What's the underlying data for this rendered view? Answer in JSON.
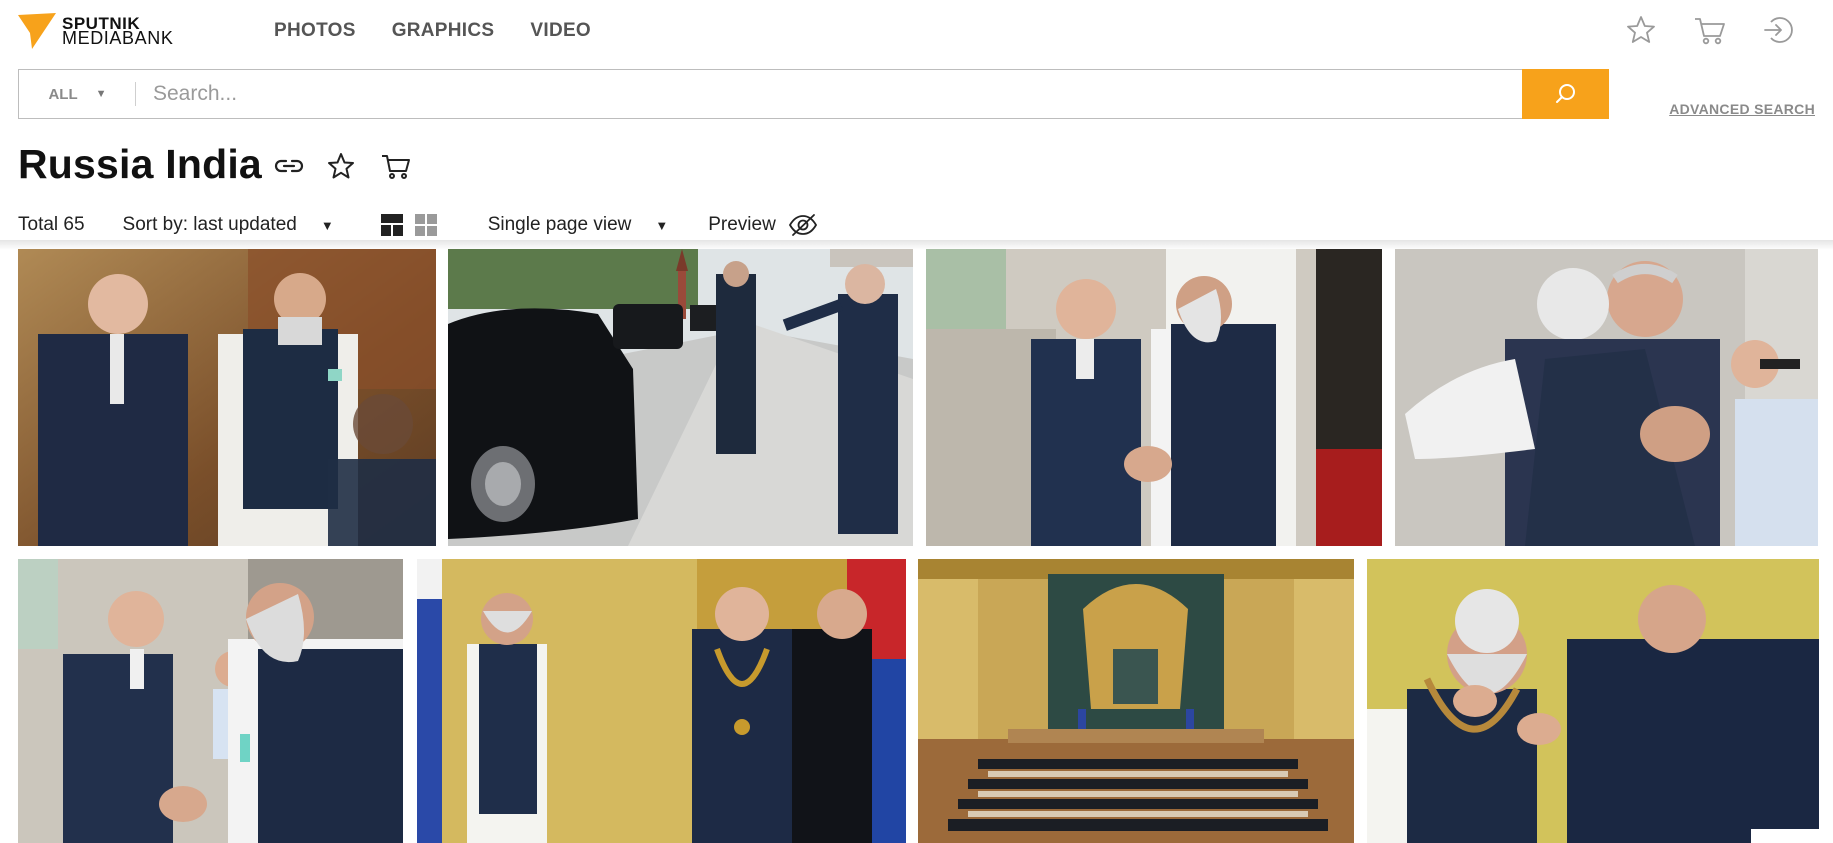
{
  "brand": {
    "line1": "SPUTNIK",
    "line2": "MEDIABANK",
    "accent": "#f7a21b"
  },
  "nav": [
    "PHOTOS",
    "GRAPHICS",
    "VIDEO"
  ],
  "header_icons": [
    "star-icon",
    "cart-icon",
    "login-icon"
  ],
  "search": {
    "scope": "ALL",
    "placeholder": "Search...",
    "button_icon": "search-icon",
    "advanced": "ADVANCED SEARCH"
  },
  "collection": {
    "title": "Russia India",
    "actions": [
      "link-icon",
      "star-icon",
      "cart-icon"
    ]
  },
  "toolbar": {
    "total": "Total 65",
    "sort": "Sort by: last updated",
    "view_modes": [
      "mosaic-view-icon",
      "grid-view-icon"
    ],
    "page_view": "Single page view",
    "preview": "Preview",
    "preview_icon": "eye-off-icon"
  },
  "photos": [
    {
      "id": "photo-1",
      "scene": "two leaders walking indoors"
    },
    {
      "id": "photo-2",
      "scene": "motorcade outside Kremlin"
    },
    {
      "id": "photo-3",
      "scene": "handshake at palace entrance"
    },
    {
      "id": "photo-4",
      "scene": "embrace of two leaders"
    },
    {
      "id": "photo-5",
      "scene": "handshake by stone wall"
    },
    {
      "id": "photo-6",
      "scene": "award ceremony with order chain"
    },
    {
      "id": "photo-7",
      "scene": "ceremonial hall with audience"
    },
    {
      "id": "photo-8",
      "scene": "order placed on neck"
    }
  ]
}
